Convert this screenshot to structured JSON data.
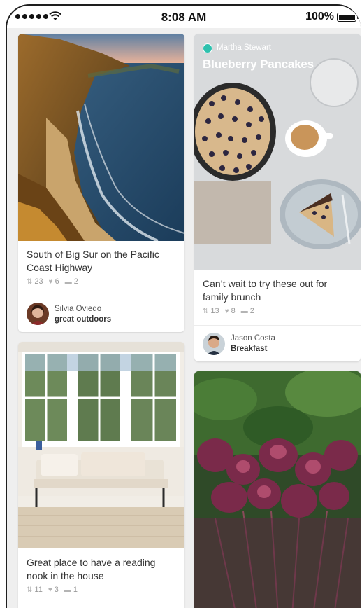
{
  "status": {
    "time": "8:08 AM",
    "battery": "100%"
  },
  "pins": [
    {
      "description": "South of Big Sur on the Pacific Coast Highway",
      "repins": "23",
      "likes": "6",
      "comments": "2",
      "pinner": "Silvia Oviedo",
      "board": "great outdoors"
    },
    {
      "source": "Martha Stewart",
      "title": "Blueberry Pancakes",
      "description": "Can’t wait to try these out for family brunch",
      "repins": "13",
      "likes": "8",
      "comments": "2",
      "pinner": "Jason Costa",
      "board": "Breakfast"
    },
    {
      "description": "Great place to have a reading nook in the house",
      "repins": "11",
      "likes": "3",
      "comments": "1"
    },
    {}
  ],
  "icons": {
    "repin": "pin-icon",
    "like": "heart-icon",
    "comment": "comment-icon"
  }
}
